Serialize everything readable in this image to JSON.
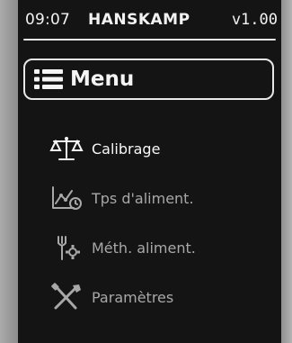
{
  "status": {
    "time": "09:07",
    "brand": "HANSKAMP",
    "version": "v1.00"
  },
  "menu": {
    "title": "Menu",
    "items": [
      {
        "label": "Calibrage",
        "icon": "balance-scale-icon",
        "active": true
      },
      {
        "label": "Tps d'aliment.",
        "icon": "chart-clock-icon",
        "active": false
      },
      {
        "label": "Méth. aliment.",
        "icon": "feed-gear-icon",
        "active": false
      },
      {
        "label": "Paramètres",
        "icon": "tools-icon",
        "active": false
      }
    ]
  },
  "colors": {
    "screen_bg": "#141414",
    "text_active": "#f7f7f7",
    "text_dim": "#a8a8a8",
    "bezel": "#9b9b9b"
  }
}
